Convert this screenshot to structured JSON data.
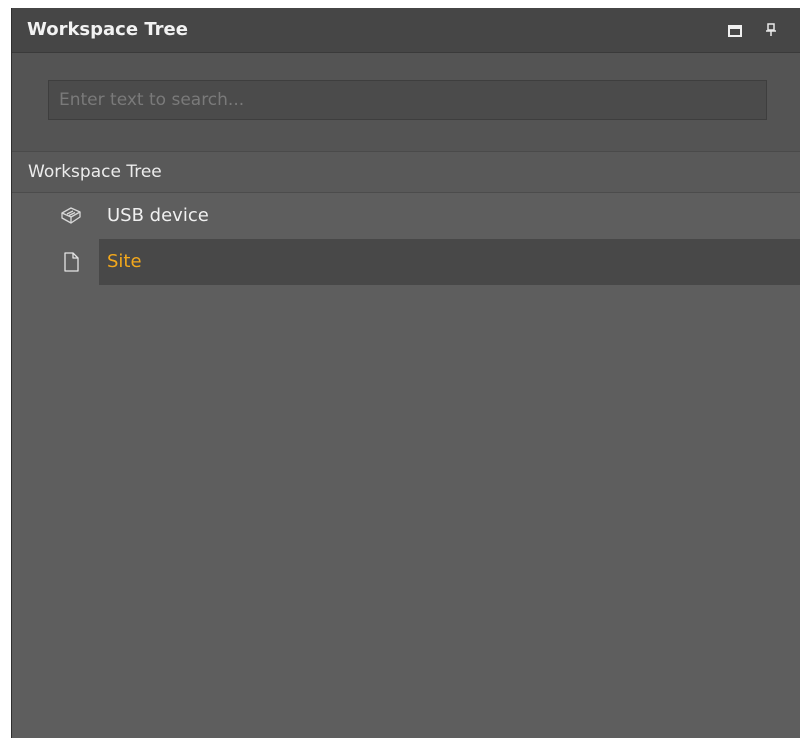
{
  "panel": {
    "title": "Workspace Tree",
    "maximize_icon": "maximize-icon",
    "pin_icon": "pin-icon"
  },
  "search": {
    "placeholder": "Enter text to search...",
    "value": ""
  },
  "tree": {
    "header": "Workspace Tree",
    "items": [
      {
        "label": "USB device",
        "icon": "usb-device-icon",
        "selected": false
      },
      {
        "label": "Site",
        "icon": "document-icon",
        "selected": true
      }
    ]
  },
  "colors": {
    "panel_bg": "#5e5e5e",
    "titlebar_bg": "#464646",
    "selected_row_bg": "#484848",
    "selected_text": "#f3a81c"
  }
}
